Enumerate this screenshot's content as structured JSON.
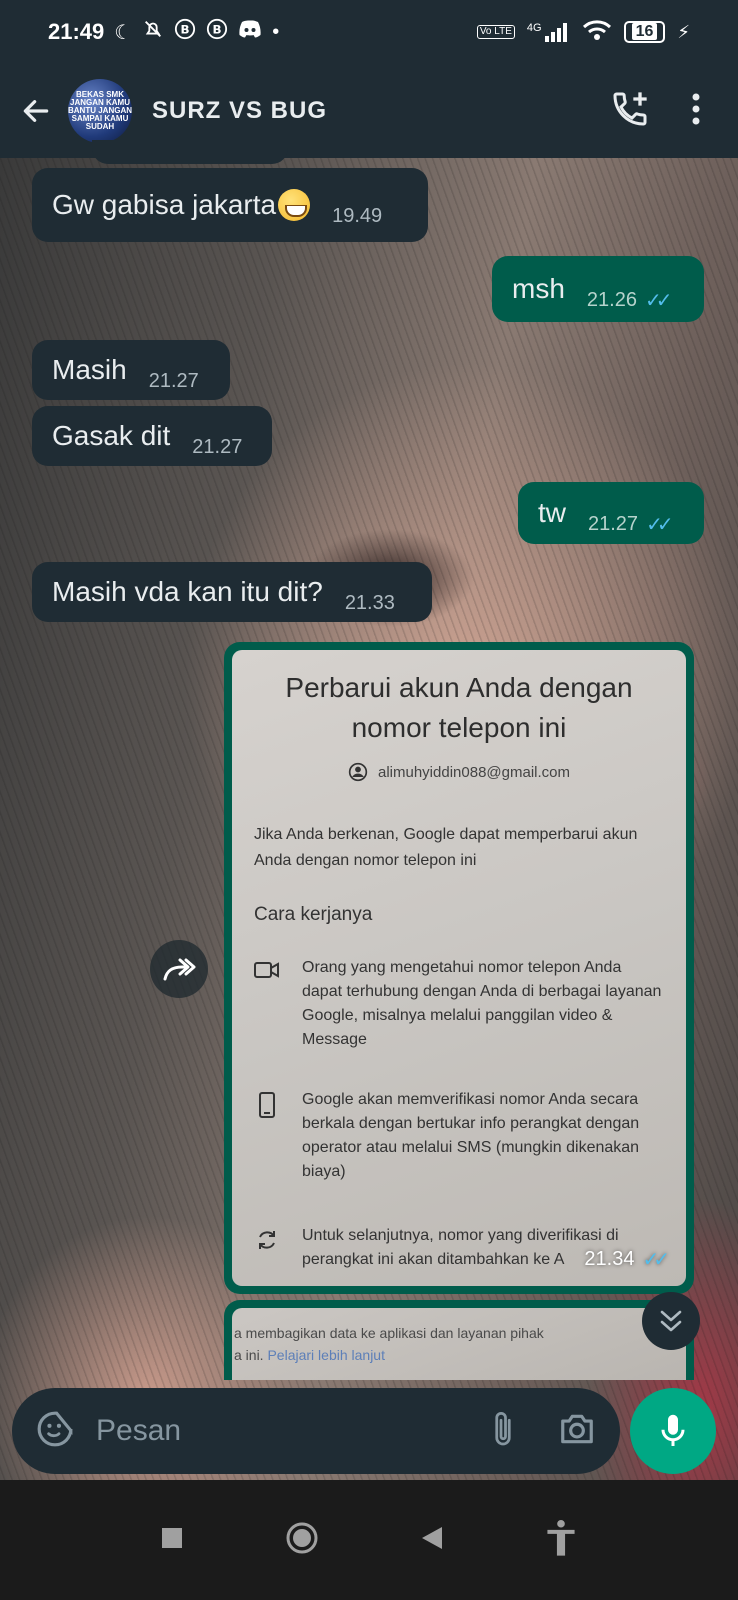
{
  "status_bar": {
    "time": "21:49",
    "network": "4G",
    "volte": "Vo LTE",
    "battery": "16"
  },
  "header": {
    "title": "SURZ VS BUG",
    "avatar_text": "BEKAS SMK JANGAN KAMU BANTU JANGAN SAMPAI KAMU SUDAH"
  },
  "messages": [
    {
      "dir": "in",
      "text": "Gw gabisa jakarta",
      "time": "19.49"
    },
    {
      "dir": "out",
      "text": "msh",
      "time": "21.26"
    },
    {
      "dir": "in",
      "text": "Masih",
      "time": "21.27"
    },
    {
      "dir": "in",
      "text": "Gasak dit",
      "time": "21.27"
    },
    {
      "dir": "out",
      "text": "tw",
      "time": "21.27"
    },
    {
      "dir": "in",
      "text": "Masih vda kan itu dit?",
      "time": "21.33"
    }
  ],
  "image_message": {
    "time": "21.34",
    "title": "Perbarui akun Anda dengan nomor telepon ini",
    "email": "alimuhyiddin088@gmail.com",
    "intro": "Jika Anda berkenan, Google dapat memperbarui akun Anda dengan nomor telepon ini",
    "heading": "Cara kerjanya",
    "items": [
      "Orang yang mengetahui nomor telepon Anda dapat terhubung dengan Anda di berbagai layanan Google, misalnya melalui panggilan video & Message",
      "Google akan memverifikasi nomor Anda secara berkala dengan bertukar info perangkat dengan operator atau melalui SMS (mungkin dikenakan biaya)",
      "Untuk selanjutnya, nomor yang diverifikasi di perangkat ini akan ditambahkan ke A"
    ]
  },
  "image_message_2": {
    "line1": "a membagikan data ke aplikasi dan layanan pihak",
    "line2_text": "a ini.",
    "line2_link": "Pelajari lebih lanjut"
  },
  "input": {
    "placeholder": "Pesan"
  },
  "colors": {
    "header_bg": "#1f2c34",
    "incoming_bubble": "#1f2c34",
    "outgoing_bubble": "#005c4b",
    "mic_button": "#00a884",
    "read_ticks": "#53bdeb"
  }
}
